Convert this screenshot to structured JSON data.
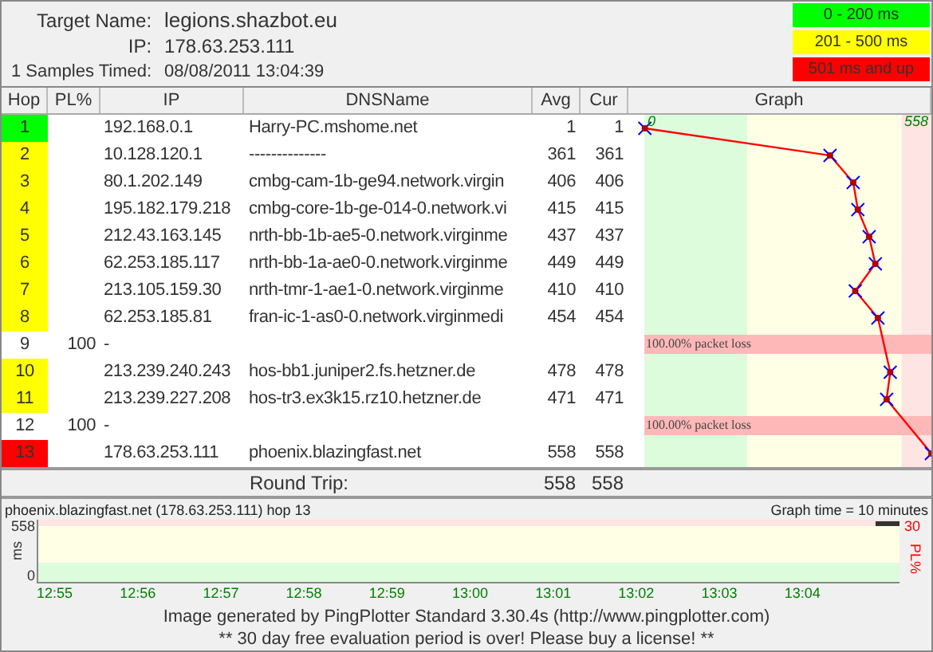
{
  "target": {
    "name_label": "Target Name:",
    "name": "legions.shazbot.eu",
    "ip_label": "IP:",
    "ip": "178.63.253.111",
    "samples_label": "1 Samples Timed:",
    "timed": "08/08/2011 13:04:39"
  },
  "legend": [
    {
      "label": "0 - 200 ms",
      "color": "#00ff00"
    },
    {
      "label": "201 - 500 ms",
      "color": "#ffff00"
    },
    {
      "label": "501 ms and up",
      "color": "#ff0000"
    }
  ],
  "columns": [
    "Hop",
    "PL%",
    "IP",
    "DNSName",
    "Avg",
    "Cur",
    "Graph"
  ],
  "rows": [
    {
      "hop": "1",
      "ip": "192.168.0.1",
      "dns": "Harry-PC.mshome.net",
      "avg": "1",
      "cur": "1",
      "color": "#00ff00"
    },
    {
      "hop": "2",
      "ip": "10.128.120.1",
      "dns": "--------------",
      "avg": "361",
      "cur": "361",
      "color": "#ffff00"
    },
    {
      "hop": "3",
      "ip": "80.1.202.149",
      "dns": "cmbg-cam-1b-ge94.network.virgin",
      "avg": "406",
      "cur": "406",
      "color": "#ffff00"
    },
    {
      "hop": "4",
      "ip": "195.182.179.218",
      "dns": "cmbg-core-1b-ge-014-0.network.vi",
      "avg": "415",
      "cur": "415",
      "color": "#ffff00"
    },
    {
      "hop": "5",
      "ip": "212.43.163.145",
      "dns": "nrth-bb-1b-ae5-0.network.virginme",
      "avg": "437",
      "cur": "437",
      "color": "#ffff00"
    },
    {
      "hop": "6",
      "ip": "62.253.185.117",
      "dns": "nrth-bb-1a-ae0-0.network.virginme",
      "avg": "449",
      "cur": "449",
      "color": "#ffff00"
    },
    {
      "hop": "7",
      "ip": "213.105.159.30",
      "dns": "nrth-tmr-1-ae1-0.network.virginme",
      "avg": "410",
      "cur": "410",
      "color": "#ffff00"
    },
    {
      "hop": "8",
      "ip": "62.253.185.81",
      "dns": "fran-ic-1-as0-0.network.virginmedi",
      "avg": "454",
      "cur": "454",
      "color": "#ffff00"
    },
    {
      "hop": "9",
      "pl": "100",
      "ip": "-",
      "graph_note": "100.00% packet loss"
    },
    {
      "hop": "10",
      "ip": "213.239.240.243",
      "dns": "hos-bb1.juniper2.fs.hetzner.de",
      "avg": "478",
      "cur": "478",
      "color": "#ffff00"
    },
    {
      "hop": "11",
      "ip": "213.239.227.208",
      "dns": "hos-tr3.ex3k15.rz10.hetzner.de",
      "avg": "471",
      "cur": "471",
      "color": "#ffff00"
    },
    {
      "hop": "12",
      "pl": "100",
      "ip": "-",
      "graph_note": "100.00% packet loss"
    },
    {
      "hop": "13",
      "ip": "178.63.253.111",
      "dns": "phoenix.blazingfast.net",
      "avg": "558",
      "cur": "558",
      "color": "#ff0000"
    }
  ],
  "graph": {
    "min_label": "0",
    "max_label": "558"
  },
  "round_trip": {
    "label": "Round Trip:",
    "avg": "558",
    "cur": "558"
  },
  "time_graph": {
    "title": "phoenix.blazingfast.net (178.63.253.111) hop 13",
    "graph_time": "Graph time = 10 minutes",
    "y_max": "558",
    "y_min": "0",
    "y_unit": "ms",
    "pl_max": "30",
    "pl_unit": "PL%",
    "x_labels": [
      "12:55",
      "12:56",
      "12:57",
      "12:58",
      "12:59",
      "13:00",
      "13:01",
      "13:02",
      "13:03",
      "13:04"
    ]
  },
  "footer": [
    "Image generated by PingPlotter Standard 3.30.4s (http://www.pingplotter.com)",
    "** 30 day free evaluation period is over!  Please buy a license! **"
  ]
}
